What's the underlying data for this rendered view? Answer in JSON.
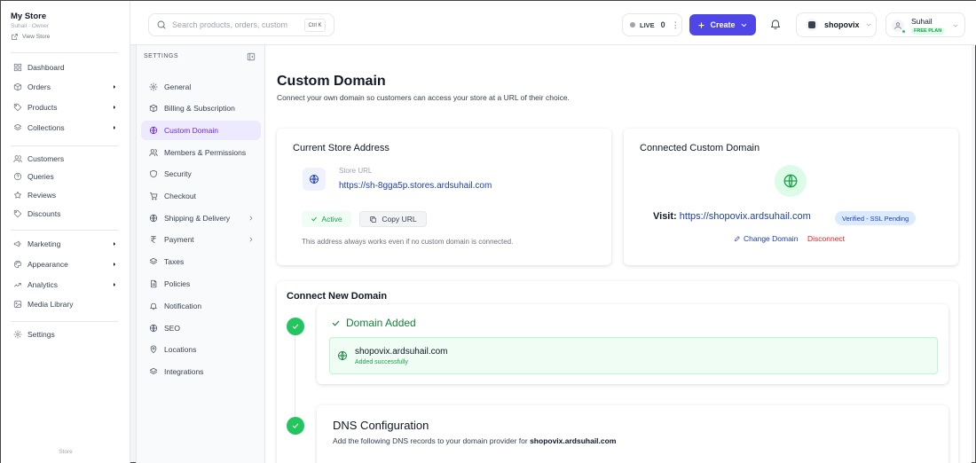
{
  "store": {
    "name": "My Store",
    "role": "Suhail · Owner",
    "view_store": "View Store"
  },
  "sidebar": {
    "items": [
      {
        "label": "Dashboard",
        "icon": "grid-icon",
        "chevron": false
      },
      {
        "label": "Orders",
        "icon": "box-icon",
        "chevron": true
      },
      {
        "label": "Products",
        "icon": "tag-icon",
        "chevron": true
      },
      {
        "label": "Collections",
        "icon": "layers-icon",
        "chevron": true
      },
      {
        "label": "Customers",
        "icon": "users-icon",
        "chevron": false
      },
      {
        "label": "Queries",
        "icon": "help-circle-icon",
        "chevron": false
      },
      {
        "label": "Reviews",
        "icon": "star-icon",
        "chevron": false
      },
      {
        "label": "Discounts",
        "icon": "ticket-icon",
        "chevron": false
      },
      {
        "label": "Marketing",
        "icon": "megaphone-icon",
        "chevron": true
      },
      {
        "label": "Appearance",
        "icon": "palette-icon",
        "chevron": true
      },
      {
        "label": "Analytics",
        "icon": "chart-icon",
        "chevron": true
      },
      {
        "label": "Media Library",
        "icon": "image-icon",
        "chevron": false
      },
      {
        "label": "Settings",
        "icon": "gear-icon",
        "chevron": false
      }
    ],
    "footer": "Store"
  },
  "topbar": {
    "search_placeholder": "Search products, orders, customers...",
    "search_shortcut": "Ctrl K",
    "live_label": "LIVE",
    "live_count": "0",
    "create_label": "Create",
    "shop_name": "shopovix",
    "user_name": "Suhail",
    "plan": "FREE PLAN"
  },
  "settings_nav": {
    "title": "SETTINGS",
    "active": "Custom Domain",
    "items": [
      {
        "label": "General",
        "icon": "gear-icon",
        "chevron": false
      },
      {
        "label": "Billing & Subscription",
        "icon": "package-icon",
        "chevron": false
      },
      {
        "label": "Custom Domain",
        "icon": "globe-icon",
        "chevron": false
      },
      {
        "label": "Members & Permissions",
        "icon": "users-icon",
        "chevron": false
      },
      {
        "label": "Security",
        "icon": "shield-icon",
        "chevron": false
      },
      {
        "label": "Checkout",
        "icon": "cart-icon",
        "chevron": false
      },
      {
        "label": "Shipping & Delivery",
        "icon": "globe-icon",
        "chevron": true
      },
      {
        "label": "Payment",
        "icon": "rupee-icon",
        "chevron": true
      },
      {
        "label": "Taxes",
        "icon": "layers-icon",
        "chevron": false
      },
      {
        "label": "Policies",
        "icon": "document-icon",
        "chevron": false
      },
      {
        "label": "Notification",
        "icon": "bell-icon",
        "chevron": false
      },
      {
        "label": "SEO",
        "icon": "globe-icon",
        "chevron": false
      },
      {
        "label": "Locations",
        "icon": "map-pin-icon",
        "chevron": false
      },
      {
        "label": "Integrations",
        "icon": "layers-icon",
        "chevron": false
      }
    ]
  },
  "page": {
    "title": "Custom Domain",
    "subtitle": "Connect your own domain so customers can access your store at a URL of their choice."
  },
  "current_address": {
    "heading": "Current Store Address",
    "url_label": "Store URL",
    "url": "https://sh-8gga5p.stores.ardsuhail.com",
    "status": "Active",
    "copy_label": "Copy URL",
    "note": "This address always works even if no custom domain is connected."
  },
  "connected_domain": {
    "heading": "Connected Custom Domain",
    "visit_label": "Visit:",
    "url": "https://shopovix.ardsuhail.com",
    "badge": "Verified - SSL Pending",
    "change_label": "Change Domain",
    "disconnect_label": "Disconnect"
  },
  "connect_new": {
    "heading": "Connect New Domain",
    "step1": {
      "title": "Domain Added",
      "domain": "shopovix.ardsuhail.com",
      "status": "Added successfully"
    },
    "step2": {
      "title": "DNS Configuration",
      "desc_prefix": "Add the following DNS records to your domain provider for",
      "desc_domain": "shopovix.ardsuhail.com"
    }
  },
  "colors": {
    "accent": "#4f46e5",
    "active_nav_bg": "#ede9fe",
    "success": "#22c55e",
    "link": "#1e40af",
    "danger": "#dc2626"
  }
}
